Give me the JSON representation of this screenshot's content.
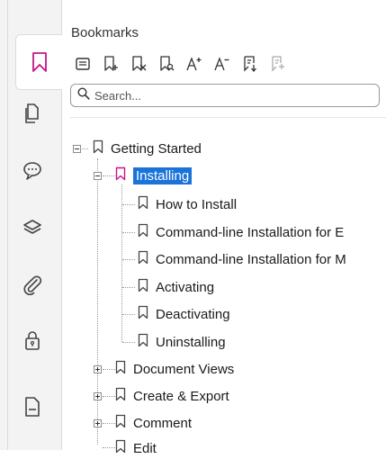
{
  "panel": {
    "title": "Bookmarks"
  },
  "search": {
    "placeholder": "Search..."
  },
  "rail": {
    "items": [
      {
        "icon": "bookmark-icon",
        "active": true
      },
      {
        "icon": "pages-icon"
      },
      {
        "icon": "comment-icon"
      },
      {
        "icon": "layers-icon"
      },
      {
        "icon": "attachment-icon"
      },
      {
        "icon": "lock-icon"
      },
      {
        "icon": "document-icon"
      }
    ]
  },
  "toolbar": {
    "tools": [
      "options-menu-icon",
      "add-bookmark-icon",
      "delete-bookmark-icon",
      "find-bookmark-icon",
      "increase-font-icon",
      "decrease-font-icon",
      "expand-bookmark-icon",
      "tag-bookmark-icon"
    ]
  },
  "tree": {
    "items": [
      {
        "label": "Getting Started",
        "level": 0,
        "state": "expanded"
      },
      {
        "label": "Installing",
        "level": 1,
        "state": "expanded",
        "selected": true
      },
      {
        "label": "How to Install",
        "level": 2
      },
      {
        "label": "Command-line Installation for E",
        "level": 2
      },
      {
        "label": "Command-line Installation for M",
        "level": 2
      },
      {
        "label": "Activating",
        "level": 2
      },
      {
        "label": "Deactivating",
        "level": 2
      },
      {
        "label": "Uninstalling",
        "level": 2
      },
      {
        "label": "Document Views",
        "level": 1,
        "state": "collapsed"
      },
      {
        "label": "Create & Export",
        "level": 1,
        "state": "collapsed"
      },
      {
        "label": "Comment",
        "level": 1,
        "state": "collapsed"
      },
      {
        "label": "Edit",
        "level": 1
      }
    ]
  },
  "colors": {
    "accent": "#c3158c",
    "selection": "#1a73d9"
  }
}
